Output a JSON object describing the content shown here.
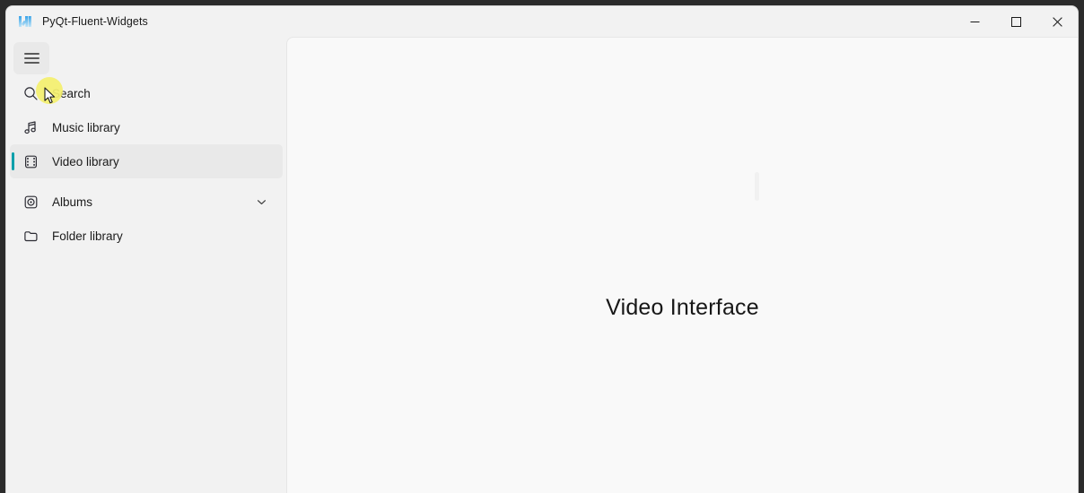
{
  "window": {
    "title": "PyQt-Fluent-Widgets",
    "logo_icon": "w-logo-icon",
    "controls": [
      {
        "name": "minimize",
        "label": "—",
        "icon": "minimize-icon"
      },
      {
        "name": "maximize",
        "label": "□",
        "icon": "maximize-icon"
      },
      {
        "name": "close",
        "label": "✕",
        "icon": "close-icon"
      }
    ]
  },
  "sidebar": {
    "menu_button": {
      "label": "Menu",
      "icon": "hamburger-menu-icon"
    },
    "selection_indicator_color": "#009faa",
    "selected_background": "#e9e9e9",
    "background": "#f2f2f2",
    "items": [
      {
        "label": "Search",
        "icon": "search-icon",
        "selected": false,
        "expandable": false
      },
      {
        "label": "Music library",
        "icon": "music-note-icon",
        "selected": false,
        "expandable": false
      },
      {
        "label": "Video library",
        "icon": "film-strip-icon",
        "selected": true,
        "expandable": false
      },
      {
        "label": "Albums",
        "icon": "album-disc-icon",
        "selected": false,
        "expandable": true,
        "expander_icon": "chevron-down-icon"
      },
      {
        "label": "Folder library",
        "icon": "folder-icon",
        "selected": false,
        "expandable": false
      }
    ]
  },
  "content": {
    "title": "Video Interface",
    "background": "#f9f9f9"
  },
  "cursor": {
    "highlight_color": "#f4f06e",
    "icon": "arrow-cursor-icon"
  }
}
